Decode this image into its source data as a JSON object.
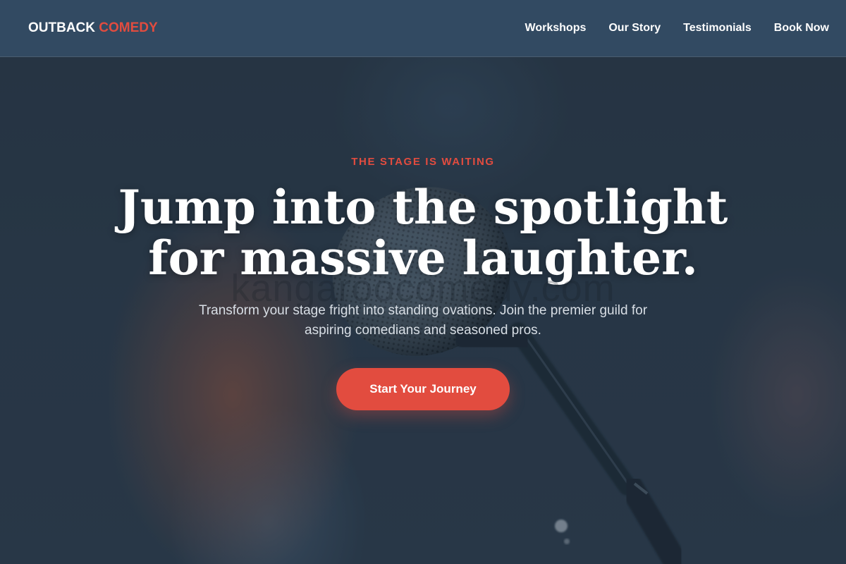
{
  "header": {
    "logo_primary": "OUTBACK",
    "logo_accent": "COMEDY",
    "nav": [
      {
        "label": "Workshops"
      },
      {
        "label": "Our Story"
      },
      {
        "label": "Testimonials"
      },
      {
        "label": "Book Now"
      }
    ]
  },
  "hero": {
    "eyebrow": "THE STAGE IS WAITING",
    "headline_line1": "Jump into the spotlight",
    "headline_line2": "for massive laughter.",
    "watermark": "kangaroocomedy.com",
    "subtext": "Transform your stage fright into standing ovations. Join the premier guild for aspiring comedians and seasoned pros.",
    "cta_label": "Start Your Journey",
    "background_icon": "microphone-icon"
  },
  "colors": {
    "accent": "#e24c3f",
    "header_bg": "#324a62",
    "hero_bg": "#2b3a4a",
    "text_light": "#ffffff",
    "text_muted": "#d8dee5"
  }
}
